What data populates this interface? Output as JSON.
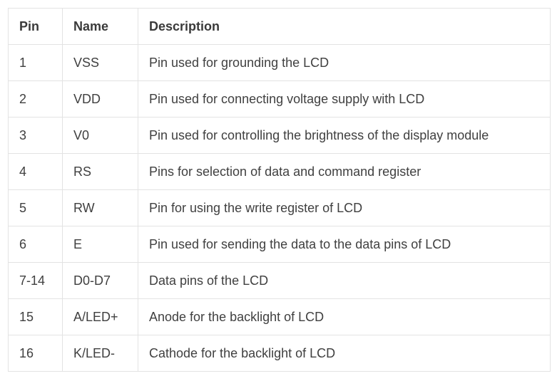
{
  "table": {
    "headers": [
      "Pin",
      "Name",
      "Description"
    ],
    "rows": [
      [
        "1",
        "VSS",
        "Pin used for grounding the LCD"
      ],
      [
        "2",
        "VDD",
        "Pin used for connecting voltage supply with LCD"
      ],
      [
        "3",
        "V0",
        "Pin used for controlling the brightness of the display module"
      ],
      [
        "4",
        "RS",
        "Pins for selection of data and command register"
      ],
      [
        "5",
        "RW",
        "Pin for using the write register of LCD"
      ],
      [
        "6",
        "E",
        "Pin used for sending the data to the data pins of LCD"
      ],
      [
        "7-14",
        "D0-D7",
        "Data pins of the LCD"
      ],
      [
        "15",
        "A/LED+",
        "Anode for the backlight of LCD"
      ],
      [
        "16",
        "K/LED-",
        "Cathode for the backlight of LCD"
      ]
    ]
  }
}
